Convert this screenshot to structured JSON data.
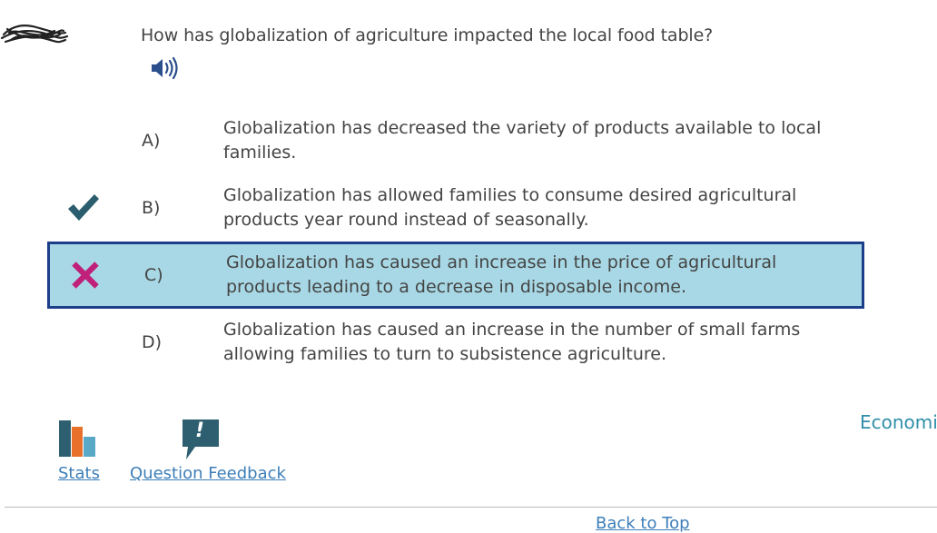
{
  "question": {
    "text": "How has globalization of agriculture impacted the local food table?"
  },
  "answers": [
    {
      "letter": "A)",
      "text": "Globalization has decreased the variety of products available to local families.",
      "state": "none"
    },
    {
      "letter": "B)",
      "text": "Globalization has allowed families to consume desired agricultural products year round instead of seasonally.",
      "state": "correct"
    },
    {
      "letter": "C)",
      "text": "Globalization has caused an increase in the price of agricultural products leading to a decrease in disposable income.",
      "state": "incorrect-selected"
    },
    {
      "letter": "D)",
      "text": "Globalization has caused an increase in the number of small farms allowing families to turn to subsistence agriculture.",
      "state": "none"
    }
  ],
  "footer": {
    "stats_label": "Stats",
    "feedback_label": "Question Feedback",
    "feedback_icon_glyph": "!",
    "category": "Economic",
    "back_to_top": "Back to Top"
  },
  "icons": {
    "audio": "speaker-icon",
    "correct": "checkmark-icon",
    "incorrect": "x-mark-icon",
    "stats": "bar-chart-icon",
    "feedback": "speech-bubble-icon"
  },
  "colors": {
    "selected_bg": "#a8d8e5",
    "selected_border": "#1d3f8a",
    "correct_mark": "#2a5d6e",
    "incorrect_mark": "#c0207a",
    "link": "#3d7eb8",
    "category": "#2f8fa8"
  }
}
